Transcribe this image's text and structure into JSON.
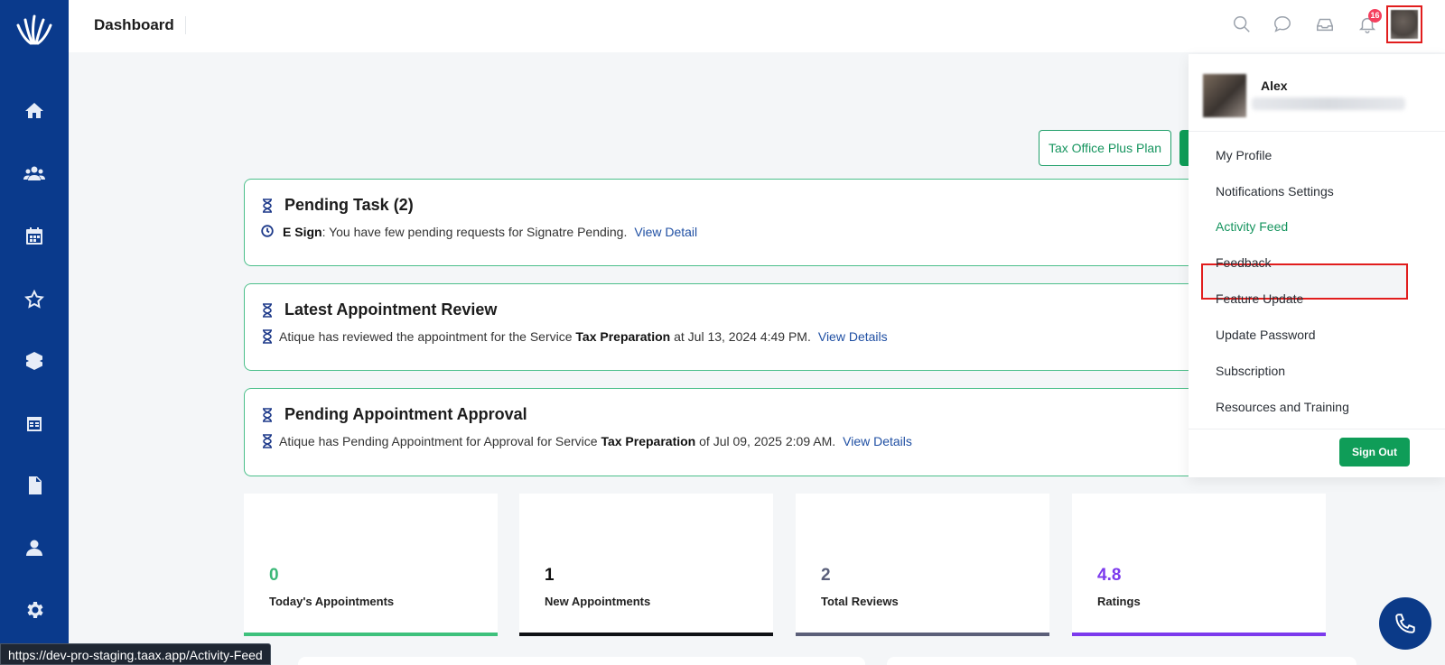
{
  "header": {
    "title": "Dashboard",
    "notification_count": "16"
  },
  "sidebar": {
    "items": [
      {
        "icon": "home-icon"
      },
      {
        "icon": "users-icon"
      },
      {
        "icon": "calendar-icon"
      },
      {
        "icon": "star-icon"
      },
      {
        "icon": "box-icon"
      },
      {
        "icon": "calendar-grid-icon"
      },
      {
        "icon": "document-icon"
      },
      {
        "icon": "user-icon"
      },
      {
        "icon": "gear-icon"
      }
    ]
  },
  "plan_button": "Tax Office Plus Plan",
  "cards": [
    {
      "title": "Pending Task (2)",
      "line_bold": "E Sign",
      "line_text": ": You have few pending requests for Signatre Pending.",
      "link": "View Detail"
    },
    {
      "title": "Latest Appointment Review",
      "line_prefix": "Atique has reviewed the appointment for the Service ",
      "line_bold": "Tax Preparation",
      "line_suffix": " at Jul 13, 2024 4:49 PM.",
      "link": "View Details"
    },
    {
      "title": "Pending Appointment Approval",
      "line_prefix": "Atique has Pending Appointment for Approval for Service ",
      "line_bold": "Tax Preparation",
      "line_suffix": " of Jul 09, 2025 2:09 AM.",
      "link": "View Details"
    }
  ],
  "stats": [
    {
      "value": "0",
      "label": "Today's Appointments",
      "color": "#3cb878"
    },
    {
      "value": "1",
      "label": "New Appointments",
      "color": "#111111"
    },
    {
      "value": "2",
      "label": "Total Reviews",
      "color": "#5a5f7a"
    },
    {
      "value": "4.8",
      "label": "Ratings",
      "color": "#7c3aed"
    }
  ],
  "profile_menu": {
    "name": "Alex",
    "items": [
      "My Profile",
      "Notifications Settings",
      "Activity Feed",
      "Feedback",
      "Feature Update",
      "Update Password",
      "Subscription",
      "Resources and Training"
    ],
    "active_item": "Activity Feed",
    "sign_out": "Sign Out"
  },
  "status_url": "https://dev-pro-staging.taax.app/Activity-Feed",
  "colors": {
    "sidebar": "#0a3a8c",
    "accent_green": "#0f9d58",
    "link": "#1f4fa3"
  }
}
